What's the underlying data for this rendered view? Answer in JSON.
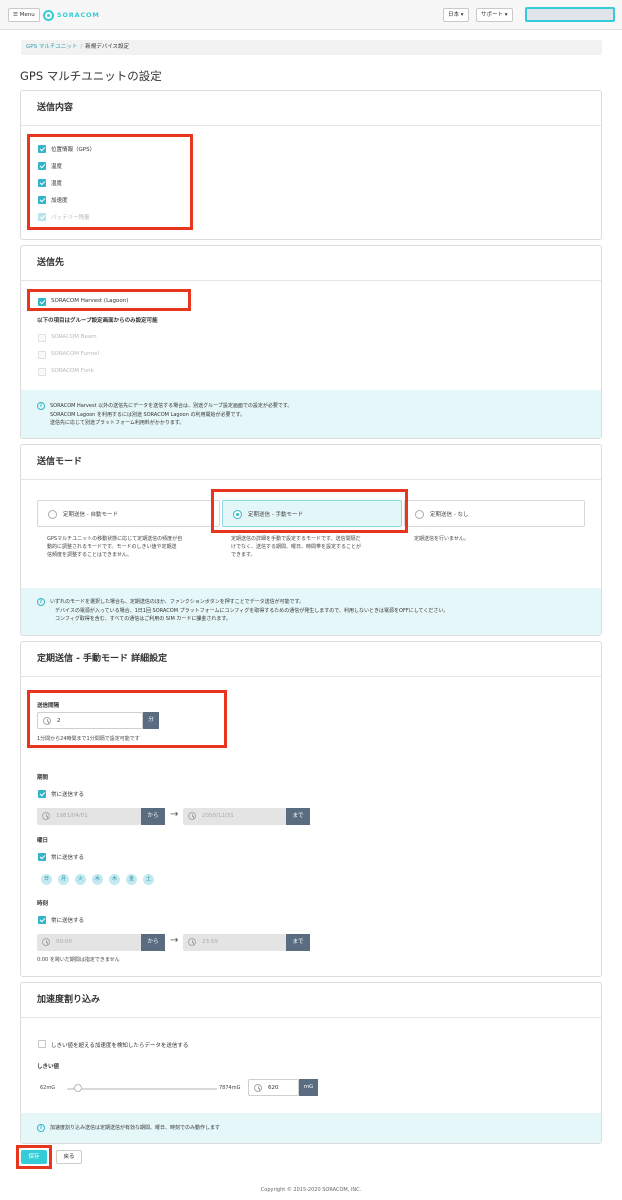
{
  "navbar": {
    "menu_label": "☰ Menu",
    "logo_text": "SORACOM",
    "language_label": "日本 ▾",
    "support_label": "サポート ▾"
  },
  "breadcrumb": {
    "parent": "GPS マルチユニット",
    "current": "新規デバイス設定"
  },
  "page_title": "GPS マルチユニットの設定",
  "send_content": {
    "heading": "送信内容",
    "items": [
      {
        "label": "位置情報（GPS）",
        "checked": true,
        "disabled": false
      },
      {
        "label": "温度",
        "checked": true,
        "disabled": false
      },
      {
        "label": "湿度",
        "checked": true,
        "disabled": false
      },
      {
        "label": "加速度",
        "checked": true,
        "disabled": false
      },
      {
        "label": "バッテリー残量",
        "checked": true,
        "disabled": true
      }
    ]
  },
  "destination": {
    "heading": "送信先",
    "harvest_label": "SORACOM Harvest (Lagoon)",
    "group_note": "以下の項目はグループ設定画面からのみ設定可能",
    "group_items": [
      "SORACOM Beam",
      "SORACOM Funnel",
      "SORACOM Funk"
    ],
    "info_lines": [
      "SORACOM Harvest 以外の送信先にデータを送信する場合は、別途グループ設定画面での設定が必要です。",
      "SORACOM Lagoon を利用するには別途 SORACOM Lagoon の利用開始が必要です。",
      "送信先に応じて別途プラットフォーム利用料がかかります。"
    ]
  },
  "send_mode": {
    "heading": "送信モード",
    "modes": [
      {
        "label": "定期送信 - 自動モード",
        "selected": false,
        "desc": [
          "GPSマルチユニットの移動状態に応じて定期送信の頻度が自",
          "動的に調整されるモードです。モードのしきい値や定期送",
          "信頻度を調整することはできません。"
        ]
      },
      {
        "label": "定期送信 - 手動モード",
        "selected": true,
        "desc": [
          "定期送信の詳細を手動で設定するモードです。送信間隔だ",
          "けでなく、送信する期間、曜日、時間帯を設定することが",
          "できます。"
        ]
      },
      {
        "label": "定期送信 - なし",
        "selected": false,
        "desc": [
          "定期送信を行いません。"
        ]
      }
    ],
    "info_lines": [
      "いずれのモードを選択した場合も、定期送信のほか、ファンクションボタンを押すことでデータ送信が可能です。",
      "デバイスの電源が入っている場合、1日1回 SORACOM プラットフォームにコンフィグを取得するための通信が発生しますので、利用しないときは電源をOFFにしてください。",
      "コンフィグ取得を含む、すべての通信はご利用の SIM カードに課金されます。"
    ]
  },
  "manual_detail": {
    "heading": "定期送信 - 手動モード 詳細設定",
    "interval_label": "送信間隔",
    "interval_value": "2",
    "interval_unit": "分",
    "interval_help": "1分間から24時間まで1分間隔で設定可能です",
    "period_label": "期間",
    "period_always": "常に送信する",
    "period_from": "1981/04/01",
    "period_from_suffix": "から",
    "period_to": "2050/12/31",
    "period_to_suffix": "まで",
    "weekday_label": "曜日",
    "weekday_always": "常に送信する",
    "weekdays": [
      "日",
      "月",
      "火",
      "水",
      "木",
      "金",
      "土"
    ],
    "time_label": "時刻",
    "time_always": "常に送信する",
    "time_from": "00:00",
    "time_from_suffix": "から",
    "time_to": "23:59",
    "time_to_suffix": "まで",
    "time_help": "0:00 を跨いだ期間は指定できません"
  },
  "acceleration": {
    "heading": "加速度割り込み",
    "threshold_check_label": "しきい値を超える加速度を検知したらデータを送信する",
    "threshold_label": "しきい値",
    "slider_min": "62mG",
    "slider_max": "7874mG",
    "slider_fraction": 0.07,
    "value": "620",
    "unit": "mG",
    "info_text": "加速度割り込み送信は定期送信が有効な期間、曜日、時刻でのみ動作します"
  },
  "actions": {
    "save_label": "保存",
    "back_label": "戻る"
  },
  "footer": "Copyright © 2015-2020 SORACOM, INC.",
  "colors": {
    "accent": "#34cdd7",
    "highlight": "#e8361e",
    "info_bg": "#e6f7f9",
    "addon": "#596c80"
  }
}
